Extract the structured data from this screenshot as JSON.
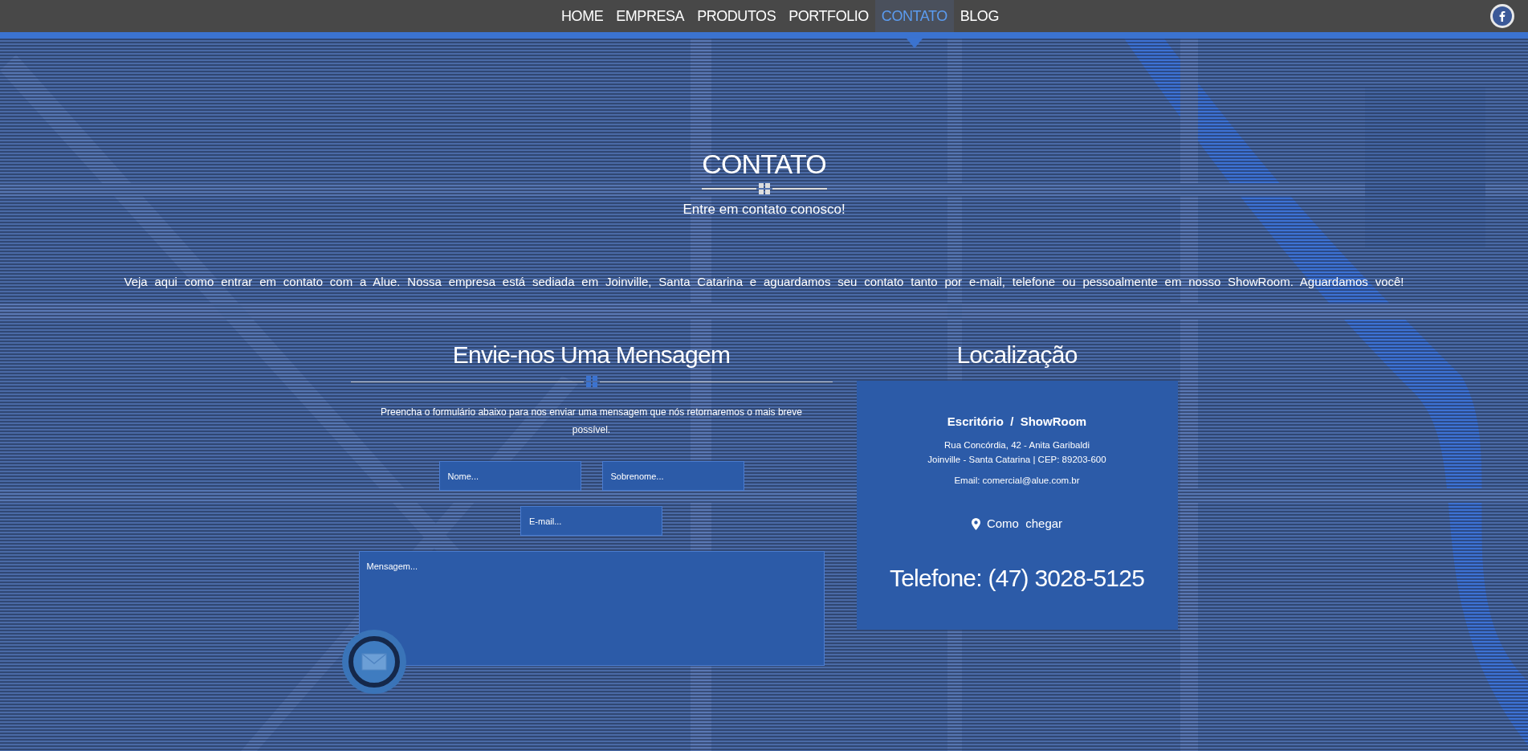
{
  "nav": {
    "items": [
      {
        "label": "HOME",
        "selected": false
      },
      {
        "label": "EMPRESA",
        "selected": false
      },
      {
        "label": "PRODUTOS",
        "selected": false
      },
      {
        "label": "PORTFOLIO",
        "selected": false
      },
      {
        "label": "CONTATO",
        "selected": true
      },
      {
        "label": "BLOG",
        "selected": false
      }
    ]
  },
  "header": {
    "title": "CONTATO",
    "subtitle": "Entre em contato conosco!"
  },
  "intro": "Veja aqui como entrar em contato com a Alue. Nossa empresa está sediada em Joinville, Santa Catarina e aguardamos seu contato tanto por e-mail, telefone ou pessoalmente em nosso ShowRoom. Aguardamos você!",
  "form": {
    "title": "Envie-nos Uma Mensagem",
    "description": "Preencha o formulário abaixo para nos enviar uma mensagem que nós retornaremos o mais breve possível.",
    "fields": [
      {
        "kind": "input",
        "placeholder": "Nome..."
      },
      {
        "kind": "input",
        "placeholder": "Sobrenome..."
      },
      {
        "kind": "input",
        "placeholder": "E-mail..."
      },
      {
        "kind": "textarea",
        "placeholder": "Mensagem..."
      }
    ]
  },
  "location": {
    "title": "Localização",
    "office": "Escritório  /  ShowRoom",
    "address_lines": [
      "Rua Concórdia, 42 - Anita Garibaldi",
      "Joinville - Santa Catarina | CEP: 89203-600"
    ],
    "email": "Email: comercial@alue.com.br",
    "directions_link": "Como  chegar",
    "phone": "Telefone: (47) 3028-5125"
  }
}
